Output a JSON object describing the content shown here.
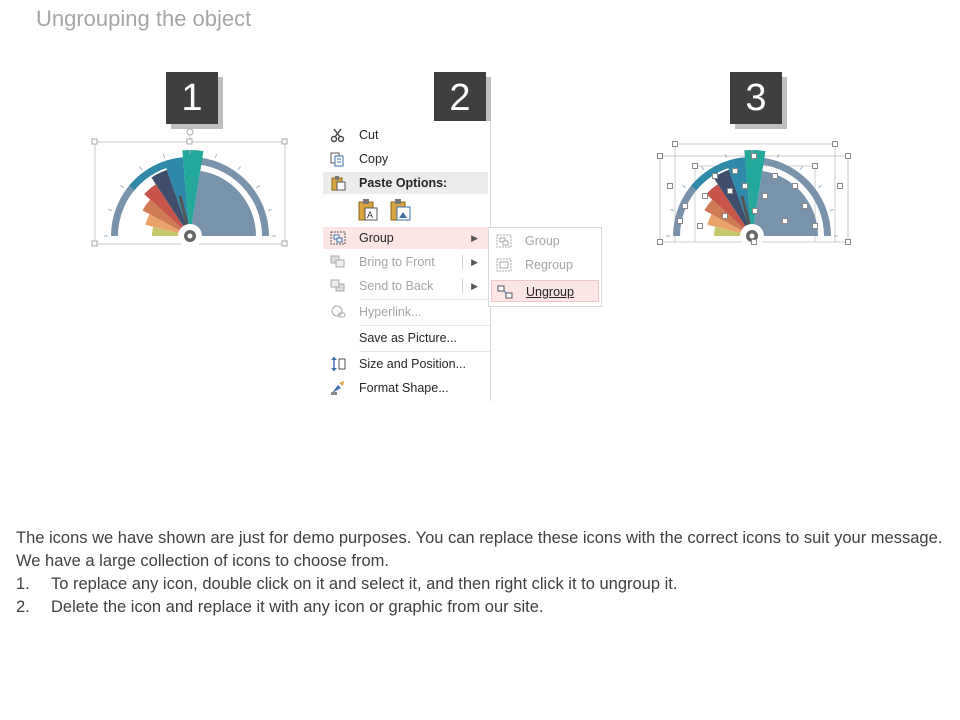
{
  "title": "Ungrouping the object",
  "steps": [
    "1",
    "2",
    "3"
  ],
  "context_menu": {
    "items": [
      {
        "label": "Cut",
        "icon": "scissors-icon",
        "enabled": true
      },
      {
        "label": "Copy",
        "icon": "copy-icon",
        "enabled": true
      },
      {
        "label": "Paste Options:",
        "icon": "paste-icon",
        "enabled": true
      },
      {
        "label": "Group",
        "icon": "group-icon",
        "enabled": true,
        "submenu": true
      },
      {
        "label": "Bring to Front",
        "icon": "bring-to-front-icon",
        "enabled": false,
        "submenu": true
      },
      {
        "label": "Send to Back",
        "icon": "send-to-back-icon",
        "enabled": false,
        "submenu": true
      },
      {
        "label": "Hyperlink...",
        "icon": "hyperlink-icon",
        "enabled": false
      },
      {
        "label": "Save as Picture...",
        "enabled": true
      },
      {
        "label": "Size and Position...",
        "icon": "size-position-icon",
        "enabled": true
      },
      {
        "label": "Format Shape...",
        "icon": "format-shape-icon",
        "enabled": true
      }
    ],
    "paste_icons": [
      "paste-keep-text-icon",
      "paste-picture-icon"
    ]
  },
  "submenu": {
    "items": [
      {
        "label": "Group",
        "icon": "group-icon",
        "enabled": false
      },
      {
        "label": "Regroup",
        "icon": "regroup-icon",
        "enabled": false
      },
      {
        "label": "Ungroup",
        "icon": "ungroup-icon",
        "enabled": true,
        "highlighted": true
      }
    ]
  },
  "body": {
    "intro": "The icons we have shown are just for demo purposes. You can replace these icons with the correct icons to suit your message. We have a large collection of icons to choose from.",
    "list": [
      {
        "num": "1.",
        "text": "To replace any icon, double click on it and select it, and then right click it to ungroup it."
      },
      {
        "num": "2.",
        "text": "Delete the icon and replace it with any icon or graphic from our site."
      }
    ]
  },
  "colors": {
    "gauge_segments": [
      "#c5c96b",
      "#e8a26a",
      "#d07a55",
      "#c8554a",
      "#3f4e6d",
      "#2e8aa8",
      "#23a89a",
      "#7a93ad"
    ],
    "gauge_outer": "#7a93ad",
    "highlight": "#fbe5e5",
    "step_box": "#3f3f3f"
  }
}
